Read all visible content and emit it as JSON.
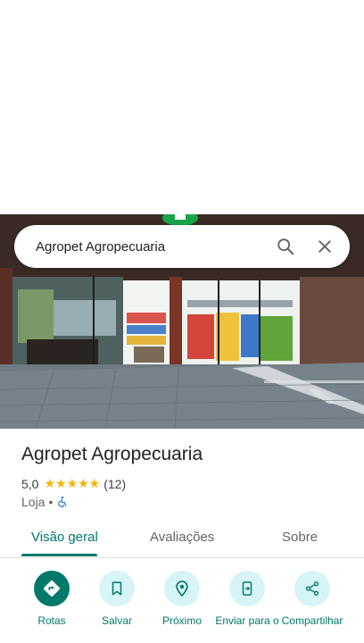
{
  "search": {
    "query": "Agropet Agropecuaria"
  },
  "place": {
    "name": "Agropet Agropecuaria",
    "rating": "5,0",
    "stars": "★★★★★",
    "review_count": "(12)",
    "category": "Loja",
    "separator": "•"
  },
  "tabs": [
    {
      "label": "Visão geral",
      "active": true
    },
    {
      "label": "Avaliações"
    },
    {
      "label": "Sobre"
    }
  ],
  "actions": [
    {
      "label": "Rotas",
      "icon": "directions-icon"
    },
    {
      "label": "Salvar",
      "icon": "bookmark-icon"
    },
    {
      "label": "Próximo",
      "icon": "nearby-icon"
    },
    {
      "label": "Enviar para o",
      "icon": "send-to-phone-icon"
    },
    {
      "label": "Compartilhar",
      "icon": "share-icon"
    }
  ],
  "colors": {
    "accent": "#00796b",
    "action_bg": "#d7f4f6",
    "star": "#f4b400"
  }
}
